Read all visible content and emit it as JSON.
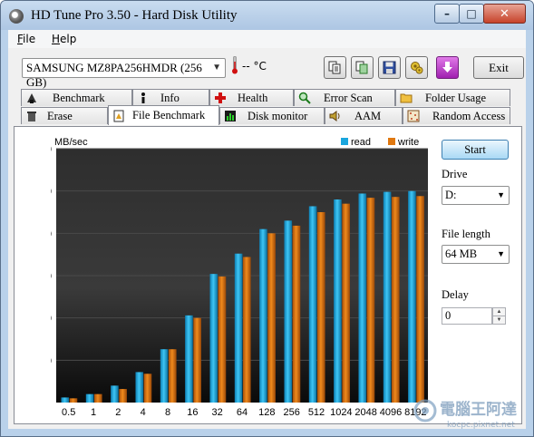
{
  "window": {
    "title": "HD Tune Pro 3.50 - Hard Disk Utility",
    "min": "–",
    "max": "□",
    "close": "✕"
  },
  "menu": [
    {
      "hot": "F",
      "rest": "ile"
    },
    {
      "hot": "H",
      "rest": "elp"
    }
  ],
  "toolbar": {
    "drive": "SAMSUNG MZ8PA256HMDR (256 GB)",
    "temperature": "-- °C",
    "exit_label": "Exit",
    "icons": [
      "copy-text-icon",
      "copy-screen-icon",
      "save-icon",
      "options-icon",
      "download-icon"
    ]
  },
  "tabs_top": [
    {
      "label": "Benchmark",
      "icon": "benchmark-icon"
    },
    {
      "label": "Info",
      "icon": "info-icon"
    },
    {
      "label": "Health",
      "icon": "health-icon"
    },
    {
      "label": "Error Scan",
      "icon": "error-scan-icon"
    },
    {
      "label": "Folder Usage",
      "icon": "folder-icon"
    }
  ],
  "tabs_bottom": [
    {
      "label": "Erase",
      "icon": "trash-icon"
    },
    {
      "label": "File Benchmark",
      "icon": "file-benchmark-icon",
      "active": true
    },
    {
      "label": "Disk monitor",
      "icon": "disk-monitor-icon"
    },
    {
      "label": "AAM",
      "icon": "speaker-icon"
    },
    {
      "label": "Random Access",
      "icon": "random-access-icon"
    }
  ],
  "side": {
    "start_label": "Start",
    "drive_label": "Drive",
    "drive_value": "D:",
    "file_length_label": "File length",
    "file_length_value": "64 MB",
    "delay_label": "Delay",
    "delay_value": "0"
  },
  "watermark": {
    "line1": "電腦王阿達",
    "line2": "kocpc.pixnet.net"
  },
  "colors": {
    "read": "#1aa6de",
    "write": "#e07810",
    "plot_bg": "#000000",
    "grid": "#4a4a4a"
  },
  "chart_data": {
    "type": "bar",
    "ylabel": "MB/sec",
    "ylim": [
      0,
      300
    ],
    "yticks": [
      50,
      100,
      150,
      200,
      250,
      300
    ],
    "categories": [
      "0.5",
      "1",
      "2",
      "4",
      "8",
      "16",
      "32",
      "64",
      "128",
      "256",
      "512",
      "1024",
      "2048",
      "4096",
      "8192"
    ],
    "series": [
      {
        "name": "read",
        "values": [
          6,
          10,
          20,
          36,
          63,
          103,
          152,
          176,
          205,
          215,
          232,
          240,
          247,
          249,
          250
        ]
      },
      {
        "name": "write",
        "values": [
          5,
          10,
          16,
          34,
          63,
          100,
          149,
          172,
          200,
          209,
          225,
          235,
          242,
          243,
          244
        ]
      }
    ],
    "legend_position": "top-right",
    "grid": true
  }
}
